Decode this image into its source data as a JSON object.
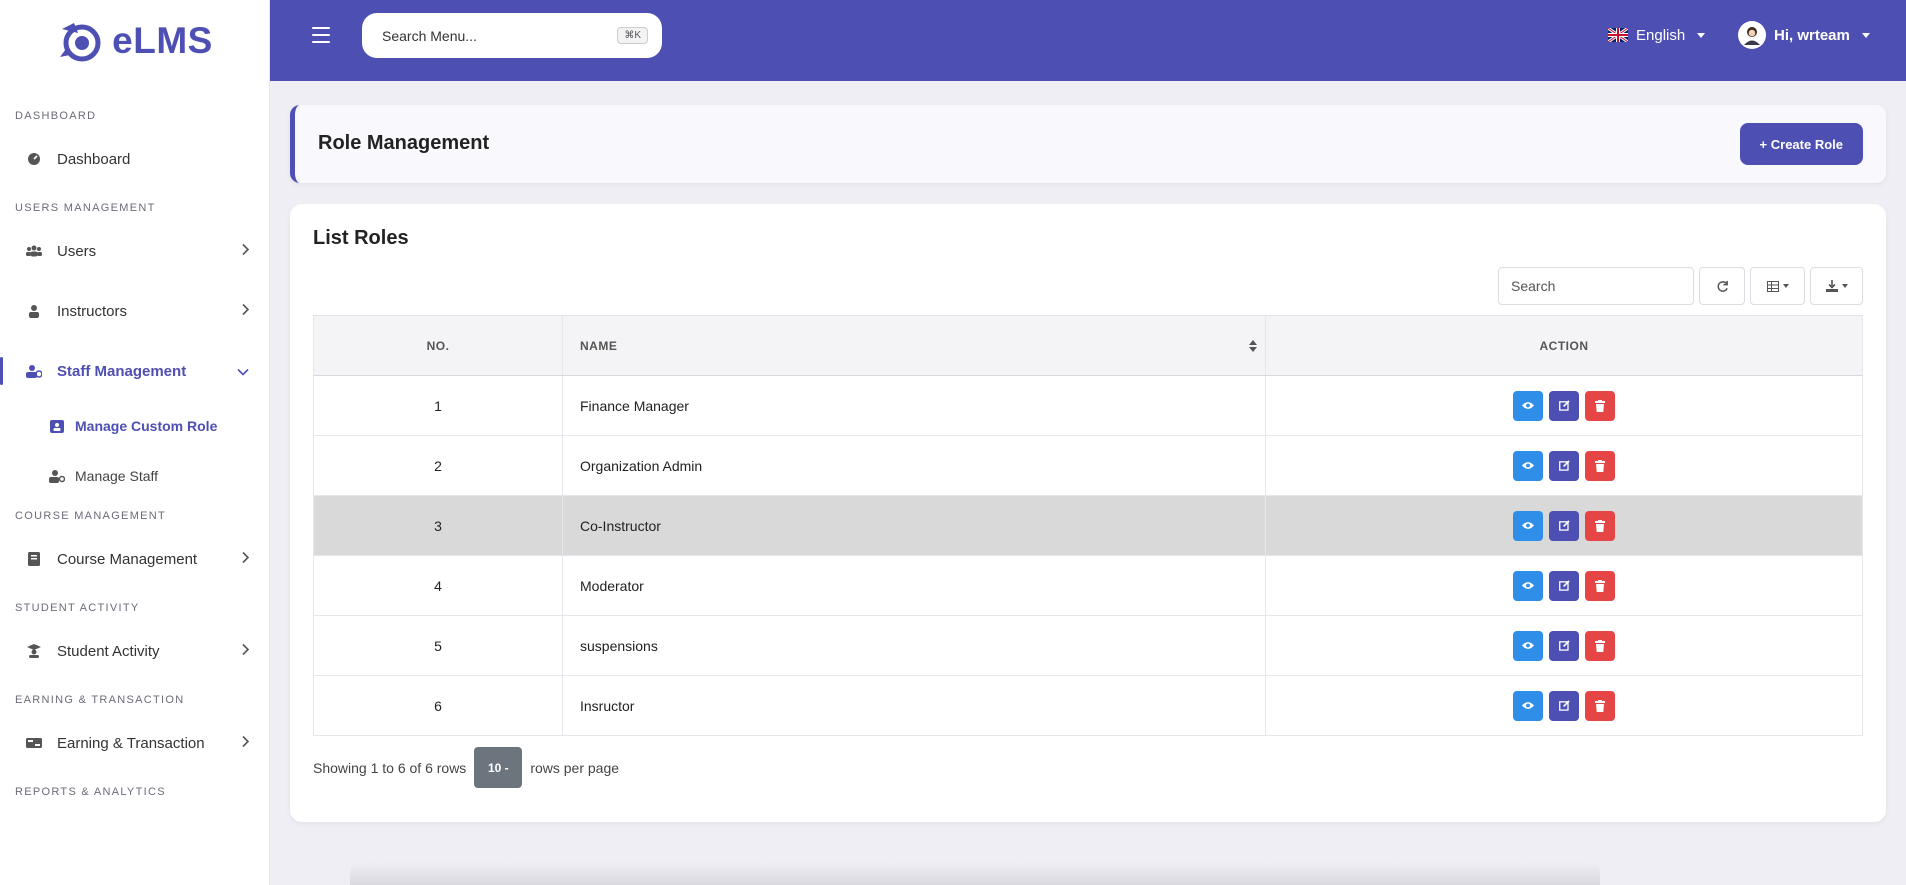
{
  "app": {
    "name": "eLMS"
  },
  "sidebar": {
    "sections": {
      "dashboard": "DASHBOARD",
      "users_management": "USERS MANAGEMENT",
      "course_management": "COURSE MANAGEMENT",
      "student_activity": "STUDENT ACTIVITY",
      "earning_transaction": "EARNING & TRANSACTION",
      "reports_analytics": "REPORTS & ANALYTICS"
    },
    "items": {
      "dashboard": "Dashboard",
      "users": "Users",
      "instructors": "Instructors",
      "staff_management": "Staff Management",
      "manage_custom_role": "Manage Custom Role",
      "manage_staff": "Manage Staff",
      "course_management": "Course Management",
      "student_activity": "Student Activity",
      "earning_transaction": "Earning & Transaction"
    }
  },
  "topbar": {
    "search_placeholder": "Search Menu...",
    "shortcut": "⌘K",
    "language": "English",
    "greeting": "Hi, wrteam"
  },
  "page": {
    "title": "Role Management",
    "create_button": "+ Create Role"
  },
  "table": {
    "title": "List Roles",
    "search_placeholder": "Search",
    "columns": {
      "no": "NO.",
      "name": "NAME",
      "action": "ACTION"
    },
    "rows": [
      {
        "no": "1",
        "name": "Finance Manager"
      },
      {
        "no": "2",
        "name": "Organization Admin"
      },
      {
        "no": "3",
        "name": "Co-Instructor"
      },
      {
        "no": "4",
        "name": "Moderator"
      },
      {
        "no": "5",
        "name": "suspensions"
      },
      {
        "no": "6",
        "name": "Insructor"
      }
    ],
    "pagination": {
      "showing": "Showing 1 to 6 of 6 rows",
      "per_page_value": "10",
      "per_page_label": "rows per page"
    }
  },
  "colors": {
    "brand": "#4e4fb3",
    "view": "#2f8ee8",
    "delete": "#e54545",
    "highlight_row": "#d9d9d9"
  }
}
